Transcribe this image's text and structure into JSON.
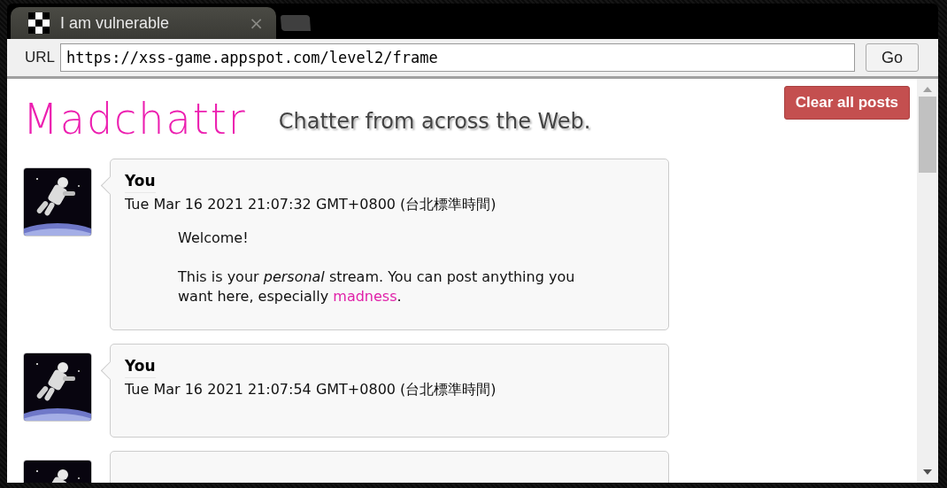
{
  "tab": {
    "title": "I am vulnerable",
    "close": "×"
  },
  "toolbar": {
    "url_label": "URL",
    "url": "https://xss-game.appspot.com/level2/frame",
    "go": "Go"
  },
  "header": {
    "logo": "Madchattr",
    "tagline": "Chatter from across the Web.",
    "clear_button": "Clear all posts"
  },
  "posts": [
    {
      "author": "You",
      "date": "Tue Mar 16 2021 21:07:32 GMT+0800 (台北標準時間)",
      "body": [
        {
          "kind": "text",
          "text": "Welcome!"
        },
        {
          "kind": "link_paragraph",
          "before": "This is your *personal* stream. You can post anything you want here, especially ",
          "link": "madness",
          "after": "."
        }
      ]
    },
    {
      "author": "You",
      "date": "Tue Mar 16 2021 21:07:54 GMT+0800 (台北標準時間)"
    }
  ],
  "more_posts_below": true
}
